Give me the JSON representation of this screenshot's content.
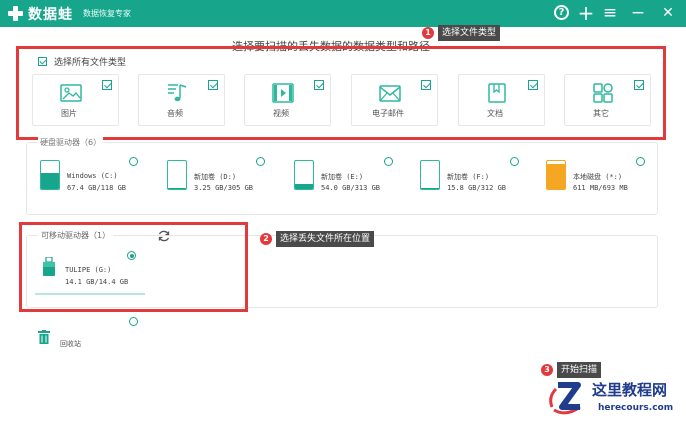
{
  "app": {
    "name": "数据蛙",
    "subtitle": "数据恢复专家"
  },
  "window_controls": {
    "help": "?",
    "add": "+",
    "menu": "≡",
    "minimize": "−",
    "close": "✕"
  },
  "prompt": "选择要扫描的丢失数据的数据类型和路径",
  "categories": {
    "select_all_label": "选择所有文件类型",
    "items": [
      {
        "label": "图片",
        "icon": "image-icon",
        "checked": true
      },
      {
        "label": "音频",
        "icon": "audio-icon",
        "checked": true
      },
      {
        "label": "视频",
        "icon": "video-icon",
        "checked": true
      },
      {
        "label": "电子邮件",
        "icon": "email-icon",
        "checked": true
      },
      {
        "label": "文档",
        "icon": "document-icon",
        "checked": true
      },
      {
        "label": "其它",
        "icon": "other-icon",
        "checked": true
      }
    ]
  },
  "disks": {
    "section_label": "硬盘驱动器（6）",
    "items": [
      {
        "name": "Windows (C:)",
        "size": "67.4 GB/118 GB",
        "used_fraction": 0.57,
        "color": "#17a58b"
      },
      {
        "name": "新加卷 (D:)",
        "size": "3.25 GB/305 GB",
        "used_fraction": 0.01,
        "color": "#17a58b"
      },
      {
        "name": "新加卷 (E:)",
        "size": "54.0 GB/313 GB",
        "used_fraction": 0.17,
        "color": "#17a58b"
      },
      {
        "name": "新加卷 (F:)",
        "size": "15.8 GB/312 GB",
        "used_fraction": 0.05,
        "color": "#17a58b"
      },
      {
        "name": "本地磁盘 (*:)",
        "size": "611 MB/693 MB",
        "used_fraction": 0.88,
        "color": "#f5a623"
      }
    ]
  },
  "removable": {
    "section_label": "可移动驱动器（1）",
    "items": [
      {
        "name": "TULIPE (G:)",
        "size": "14.1 GB/14.4 GB",
        "selected": true
      }
    ]
  },
  "recycle_bin": {
    "label": "回收站"
  },
  "annotations": [
    {
      "number": "1",
      "text": "选择文件类型"
    },
    {
      "number": "2",
      "text": "选择丢失文件所在位置"
    },
    {
      "number": "3",
      "text": "开始扫描"
    }
  ],
  "watermark": {
    "title": "这里教程网",
    "subtitle": "herecours.com"
  },
  "colors": {
    "accent": "#17a58b",
    "highlight": "#e2393c",
    "tooltip": "#4a4a4a",
    "watermark": "#1f3d8c"
  }
}
